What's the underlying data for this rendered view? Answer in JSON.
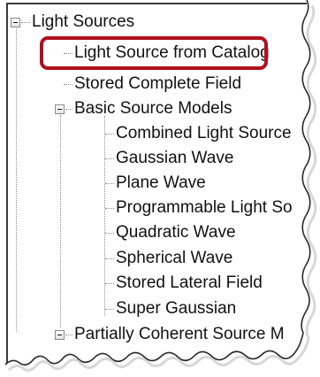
{
  "tree": {
    "root": {
      "label": "Light Sources",
      "expanded": true,
      "children": [
        {
          "label": "Light Source from Catalog",
          "highlighted": true
        },
        {
          "label": "Stored Complete Field"
        },
        {
          "label": "Basic Source Models",
          "expanded": true,
          "children": [
            {
              "label": "Combined Light Source"
            },
            {
              "label": "Gaussian Wave"
            },
            {
              "label": "Plane Wave"
            },
            {
              "label": "Programmable Light So"
            },
            {
              "label": "Quadratic Wave"
            },
            {
              "label": "Spherical Wave"
            },
            {
              "label": "Stored Lateral Field"
            },
            {
              "label": "Super Gaussian"
            }
          ]
        },
        {
          "label": "Partially Coherent Source M",
          "expanded": false
        }
      ]
    }
  },
  "colors": {
    "highlight_border": "#b0101f",
    "tree_line": "#8c8c8c",
    "frame": "#3a3a3a"
  }
}
